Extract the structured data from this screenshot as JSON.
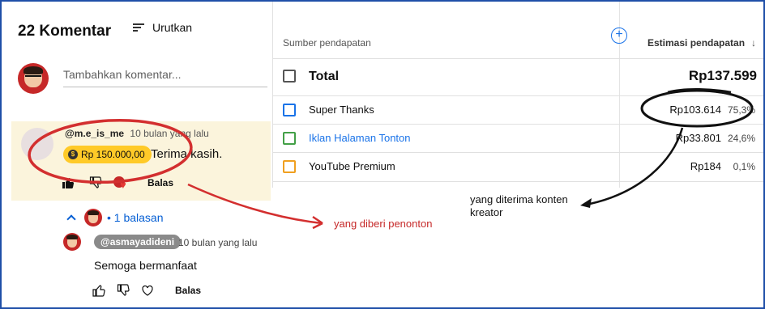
{
  "comments": {
    "count_title": "22 Komentar",
    "sort_label": "Urutkan",
    "add_placeholder": "Tambahkan komentar...",
    "first": {
      "handle": "@m.e_is_me",
      "time": "10 bulan yang lalu",
      "super_thanks_amount": "Rp 150.000,00",
      "text": "Terima kasih.",
      "reply_label": "Balas"
    },
    "replies_toggle": "1 balasan",
    "reply": {
      "handle": "@asmayadideni",
      "time": "10 bulan yang lalu",
      "text": "Semoga bermanfaat",
      "reply_label": "Balas"
    }
  },
  "revenue": {
    "header_source": "Sumber pendapatan",
    "header_estimate": "Estimasi pendapatan",
    "total_label": "Total",
    "total_value": "Rp137.599",
    "rows": [
      {
        "label": "Super Thanks",
        "value": "Rp103.614",
        "pct": "75,3%",
        "color": "#1a73e8",
        "link": false
      },
      {
        "label": "Iklan Halaman Tonton",
        "value": "Rp33.801",
        "pct": "24,6%",
        "color": "#43a047",
        "link": true
      },
      {
        "label": "YouTube Premium",
        "value": "Rp184",
        "pct": "0,1%",
        "color": "#f0a020",
        "link": false
      }
    ]
  },
  "annotations": {
    "viewer_gave": "yang diberi penonton",
    "creator_received": "yang diterima konten kreator"
  },
  "colors": {
    "accent_blue": "#065fd4",
    "annotation_red": "#c62828",
    "super_chip": "#ffca28",
    "highlight_bg": "#fbf4dc"
  }
}
